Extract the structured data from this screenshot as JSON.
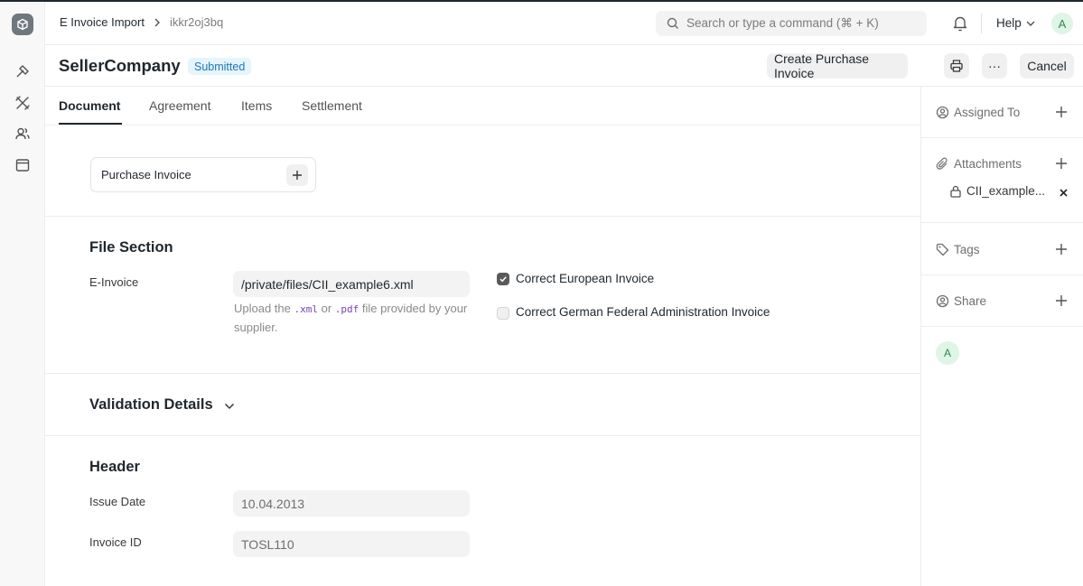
{
  "navbar": {
    "breadcrumb_doctype": "E Invoice Import",
    "breadcrumb_docname": "ikkr2oj3bq",
    "search_placeholder": "Search or type a command (⌘ + K)",
    "help_label": "Help",
    "user_initial": "A"
  },
  "titlebar": {
    "title": "SellerCompany",
    "status": "Submitted",
    "create_label": "Create Purchase Invoice",
    "more_label": "···",
    "cancel_label": "Cancel"
  },
  "tabs": [
    {
      "label": "Document",
      "active": true
    },
    {
      "label": "Agreement",
      "active": false
    },
    {
      "label": "Items",
      "active": false
    },
    {
      "label": "Settlement",
      "active": false
    }
  ],
  "connections": {
    "link_label": "Purchase Invoice"
  },
  "file_section": {
    "title": "File Section",
    "einvoice_label": "E-Invoice",
    "einvoice_value": "/private/files/CII_example6.xml",
    "help_pre": "Upload the ",
    "help_code1": ".xml",
    "help_mid": " or ",
    "help_code2": ".pdf",
    "help_post": " file provided by your supplier.",
    "checkbox1_label": "Correct European Invoice",
    "checkbox1_checked": true,
    "checkbox2_label": "Correct German Federal Administration Invoice",
    "checkbox2_checked": false
  },
  "validation": {
    "title": "Validation Details"
  },
  "header_section": {
    "title": "Header",
    "issue_date_label": "Issue Date",
    "issue_date_value": "10.04.2013",
    "invoice_id_label": "Invoice ID",
    "invoice_id_value": "TOSL110"
  },
  "sidebar": {
    "assigned_to": "Assigned To",
    "attachments": "Attachments",
    "attachment_file": "CII_example...",
    "tags": "Tags",
    "share": "Share",
    "viewer_initial": "A"
  },
  "colors": {
    "status_badge_bg": "#e6f4fc",
    "status_badge_text": "#1d79b3",
    "avatar_bg": "#dff5e5",
    "avatar_text": "#2d8a53"
  }
}
